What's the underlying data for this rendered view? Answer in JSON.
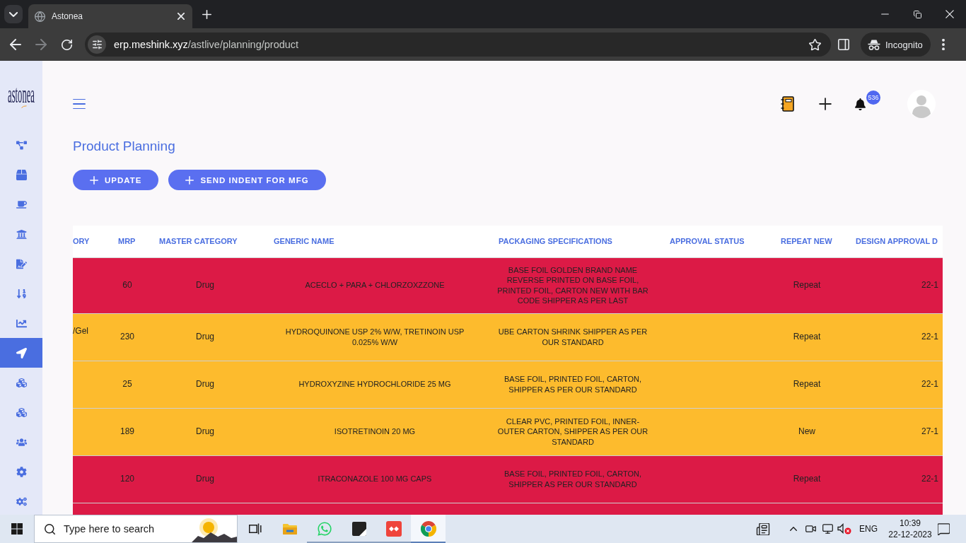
{
  "browser": {
    "tabs": [
      {
        "title": "Astonea",
        "selected": true
      }
    ],
    "back_disabled": false,
    "forward_disabled": true,
    "address": {
      "host": "erp.meshink.xyz",
      "path": "/astlive/planning/product"
    },
    "profile_label": "Incognito"
  },
  "sidebar": {
    "logo": "astonea",
    "items": [
      {
        "selected": false
      },
      {
        "selected": false
      },
      {
        "selected": false
      },
      {
        "selected": false
      },
      {
        "selected": false
      },
      {
        "selected": false
      },
      {
        "selected": false
      },
      {
        "selected": true
      },
      {
        "selected": false
      },
      {
        "selected": false
      },
      {
        "selected": false
      },
      {
        "selected": false
      },
      {
        "selected": false
      }
    ]
  },
  "header": {
    "notification_count": "536"
  },
  "page": {
    "title": "Product Planning",
    "actions": [
      {
        "label": "UPDATE"
      },
      {
        "label": "SEND INDENT FOR MFG"
      }
    ]
  },
  "table": {
    "columns": [
      "ORY",
      "MRP",
      "MASTER CATEGORY",
      "GENERIC NAME",
      "PACKAGING SPECIFICATIONS",
      "APPROVAL STATUS",
      "REPEAT NEW",
      "DESIGN APPROVAL D"
    ],
    "rows": [
      {
        "color": "#dc1a46",
        "mrp": "60",
        "master_category": "Drug",
        "generic_name": "ACECLO + PARA + CHLORZOXZZONE",
        "packaging_specifications": "BASE FOIL GOLDEN BRAND NAME REVERSE PRINTED ON BASE FOIL, PRINTED FOIL, CARTON NEW WITH BAR CODE SHIPPER AS PER LAST",
        "repeat_new": "Repeat",
        "column_8": "22-1"
      },
      {
        "color": "#fdbb2d",
        "column_1": "/Gel",
        "mrp": "230",
        "master_category": "Drug",
        "generic_name": "HYDROQUINONE USP 2% W/W, TRETINOIN USP 0.025% W/W",
        "packaging_specifications": "UBE CARTON SHRINK SHIPPER AS PER OUR STANDARD",
        "repeat_new": "Repeat",
        "column_8": "22-1"
      },
      {
        "color": "#fdbb2d",
        "mrp": "25",
        "master_category": "Drug",
        "generic_name": "HYDROXYZINE HYDROCHLORIDE 25 MG",
        "packaging_specifications": "BASE FOIL, PRINTED FOIL, CARTON, SHIPPER AS PER OUR STANDARD",
        "repeat_new": "Repeat",
        "column_8": "22-1"
      },
      {
        "color": "#fdbb2d",
        "mrp": "189",
        "master_category": "Drug",
        "generic_name": "ISOTRETINOIN 20 MG",
        "packaging_specifications": "CLEAR PVC, PRINTED FOIL, INNER-OUTER CARTON, SHIPPER AS PER OUR STANDARD",
        "repeat_new": "New",
        "column_8": "27-1"
      },
      {
        "color": "#dc1a46",
        "mrp": "120",
        "master_category": "Drug",
        "generic_name": "ITRACONAZOLE 100 MG CAPS",
        "packaging_specifications": "BASE FOIL, PRINTED FOIL, CARTON, SHIPPER AS PER OUR STANDARD",
        "repeat_new": "Repeat",
        "column_8": "22-1"
      },
      {
        "color": "#dc1a46"
      }
    ]
  },
  "taskbar": {
    "search": {
      "placeholder": "Type here to search"
    },
    "apps": [
      {
        "running": false,
        "selected": false
      },
      {
        "running": true,
        "selected": false
      },
      {
        "running": true,
        "selected": false
      },
      {
        "running": true,
        "selected": false
      },
      {
        "running": true,
        "selected": true
      }
    ],
    "tray": {
      "language": "ENG",
      "time": "10:39",
      "date": "22-12-2023"
    }
  }
}
